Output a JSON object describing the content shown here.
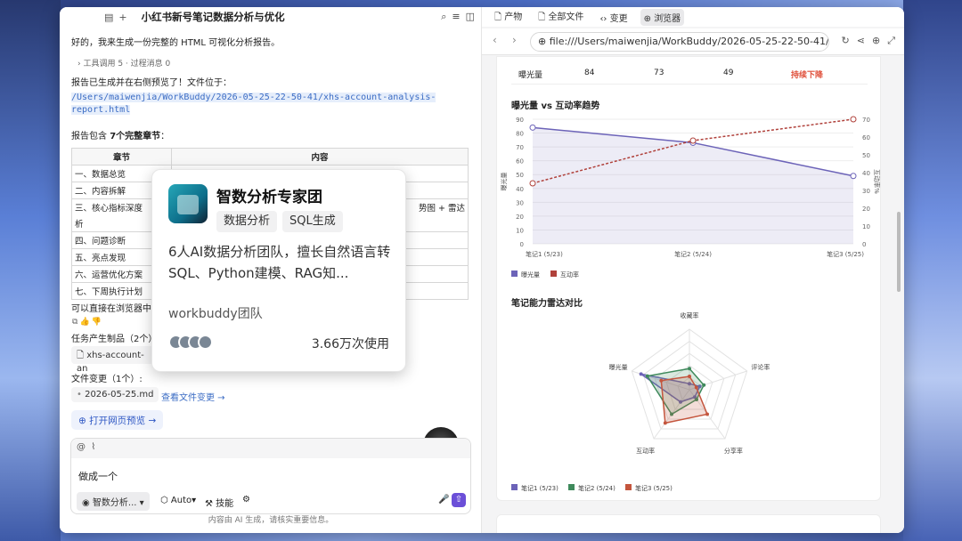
{
  "chat": {
    "title": "小红书新号笔记数据分析与优化",
    "intro": "好的，我来生成一份完整的 HTML 可视化分析报告。",
    "tools": "工具调用 5 · 过程消息 0",
    "report_line": "报告已生成并在右侧预览了！文件位于：",
    "path_line1": "/Users/maiwenjia/WorkBuddy/2026-05-25-22-50-41/xhs-account-analysis-",
    "path_line2": "report.html",
    "chapters_prefix": "报告包含 ",
    "chapters_count": "7个完整章节",
    "chapters_suffix": "：",
    "table_headers": [
      "章节",
      "内容"
    ],
    "table_rows": [
      {
        "c": "一、数据总览",
        "d": "状图"
      },
      {
        "c": "二、内容拆解",
        "d": ""
      },
      {
        "c": "三、核心指标深度",
        "d": "势图 + 雷达"
      },
      {
        "c": "析",
        "d": ""
      },
      {
        "c": "四、问题诊断",
        "d": ""
      },
      {
        "c": "五、亮点发现",
        "d": ""
      },
      {
        "c": "六、运营优化方案",
        "d": ""
      },
      {
        "c": "七、下周执行计划",
        "d": ""
      }
    ],
    "browser_line": "可以直接在浏览器中",
    "outputs_label": "任务产生制品（2个）",
    "output_file": "xhs-account-an",
    "changes_label": "文件变更（1个）:",
    "changed_file": "2026-05-25.md",
    "view_changes": "查看文件变更 →",
    "open_preview": "打开网页预览 →",
    "composer_text": "做成一个",
    "agent_chip": "智数分析...",
    "auto_label": "Auto",
    "skills_label": "技能",
    "footer": "内容由 AI 生成，请核实重要信息。"
  },
  "card": {
    "title": "智数分析专家团",
    "tags": [
      "数据分析",
      "SQL生成"
    ],
    "desc": "6人AI数据分析团队，擅长自然语言转SQL、Python建模、RAG知...",
    "team": "workbuddy团队",
    "uses": "3.66万次使用"
  },
  "browser": {
    "tabs": [
      "产物",
      "全部文件",
      "变更",
      "浏览器"
    ],
    "url": "file:///Users/maiwenjia/WorkBuddy/2026-05-25-22-50-41/xhs-ac",
    "table_row": [
      "曝光量",
      "84",
      "73",
      "49",
      "持续下降"
    ],
    "trend_alert_color": "#e0513c"
  },
  "chart_data": [
    {
      "type": "line",
      "title": "曝光量 vs 互动率趋势",
      "categories": [
        "笔记1 (5/23)",
        "笔记2 (5/24)",
        "笔记3 (5/25)"
      ],
      "series": [
        {
          "name": "曝光量",
          "values": [
            84,
            73,
            49
          ],
          "axis": "left",
          "color": "#6c63b8"
        },
        {
          "name": "互动率",
          "values": [
            34,
            58,
            70
          ],
          "axis": "right",
          "color": "#b0413b"
        }
      ],
      "ylabel": "曝光量",
      "y2label": "互动率%",
      "ylim": [
        0,
        90
      ],
      "y2lim": [
        0,
        70
      ],
      "yticks": [
        0,
        10,
        20,
        30,
        40,
        50,
        60,
        70,
        80,
        90
      ],
      "y2ticks": [
        0,
        10,
        20,
        30,
        40,
        50,
        60,
        70
      ],
      "legend": "bottom-left"
    },
    {
      "type": "radar",
      "title": "笔记能力雷达对比",
      "axes": [
        "收藏率",
        "评论率",
        "分享率",
        "互动率",
        "曝光量"
      ],
      "series": [
        {
          "name": "笔记1 (5/23)",
          "values": [
            10,
            18,
            15,
            25,
            84
          ],
          "color": "#6c63b8"
        },
        {
          "name": "笔记2 (5/24)",
          "values": [
            35,
            25,
            20,
            50,
            73
          ],
          "color": "#3f8a5c"
        },
        {
          "name": "笔记3 (5/25)",
          "values": [
            22,
            12,
            50,
            68,
            49
          ],
          "color": "#c4553d"
        }
      ],
      "rlim": [
        0,
        100
      ],
      "legend": "bottom-left"
    }
  ]
}
